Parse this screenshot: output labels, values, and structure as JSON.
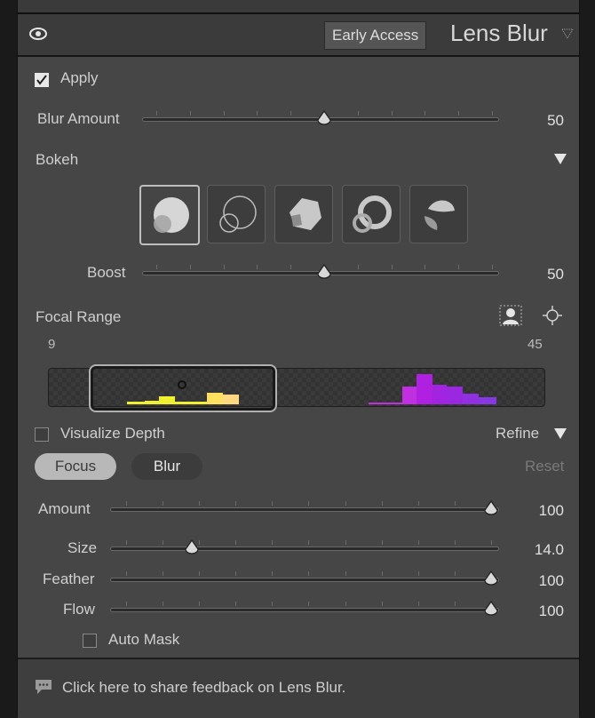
{
  "header": {
    "early_access_label": "Early Access",
    "title": "Lens Blur"
  },
  "apply": {
    "label": "Apply",
    "checked": true
  },
  "blur_amount": {
    "label": "Blur Amount",
    "value": "50",
    "level": 0.5
  },
  "bokeh": {
    "label": "Bokeh",
    "shapes": [
      "bokeh-circle",
      "bokeh-ring-soft",
      "bokeh-polygon",
      "bokeh-ring",
      "bokeh-cat-eye"
    ],
    "selected_index": 0
  },
  "boost": {
    "label": "Boost",
    "value": "50",
    "level": 0.5
  },
  "focal_range": {
    "label": "Focal Range",
    "min": "9",
    "max": "45"
  },
  "visualize_depth": {
    "label": "Visualize Depth",
    "checked": false
  },
  "refine": {
    "label": "Refine"
  },
  "mode_tabs": {
    "focus": "Focus",
    "blur": "Blur",
    "reset": "Reset"
  },
  "amount": {
    "label": "Amount",
    "value": "100",
    "level": 1.0
  },
  "size": {
    "label": "Size",
    "value": "14.0",
    "level": 0.18
  },
  "feather": {
    "label": "Feather",
    "value": "100",
    "level": 1.0
  },
  "flow": {
    "label": "Flow",
    "value": "100",
    "level": 1.0
  },
  "auto_mask": {
    "label": "Auto Mask",
    "checked": false
  },
  "footer": {
    "feedback_text": "Click here to share feedback on Lens Blur."
  },
  "colors": {
    "panel": "#464646",
    "header": "#3b3b3b",
    "histo_near": "#f5f53c",
    "histo_far": "#a020f0"
  }
}
